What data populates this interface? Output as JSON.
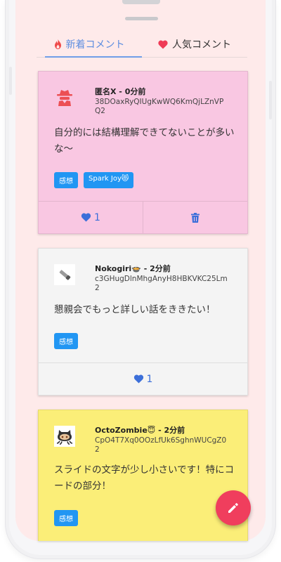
{
  "tabs": [
    {
      "label": "新着コメント",
      "icon": "flame-icon",
      "active": true
    },
    {
      "label": "人気コメント",
      "icon": "heart-icon",
      "active": false
    }
  ],
  "comments": [
    {
      "author": "匿名X - 0分前",
      "token": "38DOaxRyQIUgKwWQ6KmQjLZnVPQ2",
      "message": "自分的には結構理解できてないことが多いな〜",
      "tags": [
        "感想",
        "Spark Joy😻"
      ],
      "likes": "1",
      "background": "#f9c7e2",
      "avatar_icon": "anonymous-spy-icon",
      "has_delete": true
    },
    {
      "author": "Nokogiri🍲 - 2分前",
      "token": "c3GHugDlnMhgAnyH8HBKVKC25Lm2",
      "message": "懇親会でもっと詳しい話をききたい！",
      "tags": [
        "感想"
      ],
      "likes": "1",
      "background": "#f4f4f4",
      "avatar_icon": "saw-icon",
      "has_delete": false
    },
    {
      "author": "OctoZombie😇 - 2分前",
      "token": "CpO4T7Xq0OOzLfUk6SghnWUCgZ02",
      "message": "スライドの文字が少し小さいです！特にコードの部分！",
      "tags": [
        "感想"
      ],
      "background": "#fbee78",
      "avatar_icon": "octocat-icon"
    }
  ],
  "fab": {
    "icon": "pencil-icon"
  },
  "colors": {
    "accent": "#5c8de0",
    "tag": "#2196f3",
    "fab": "#f03e5d",
    "heart": "#3c6fd9",
    "screen_bg": "#feeaea"
  }
}
